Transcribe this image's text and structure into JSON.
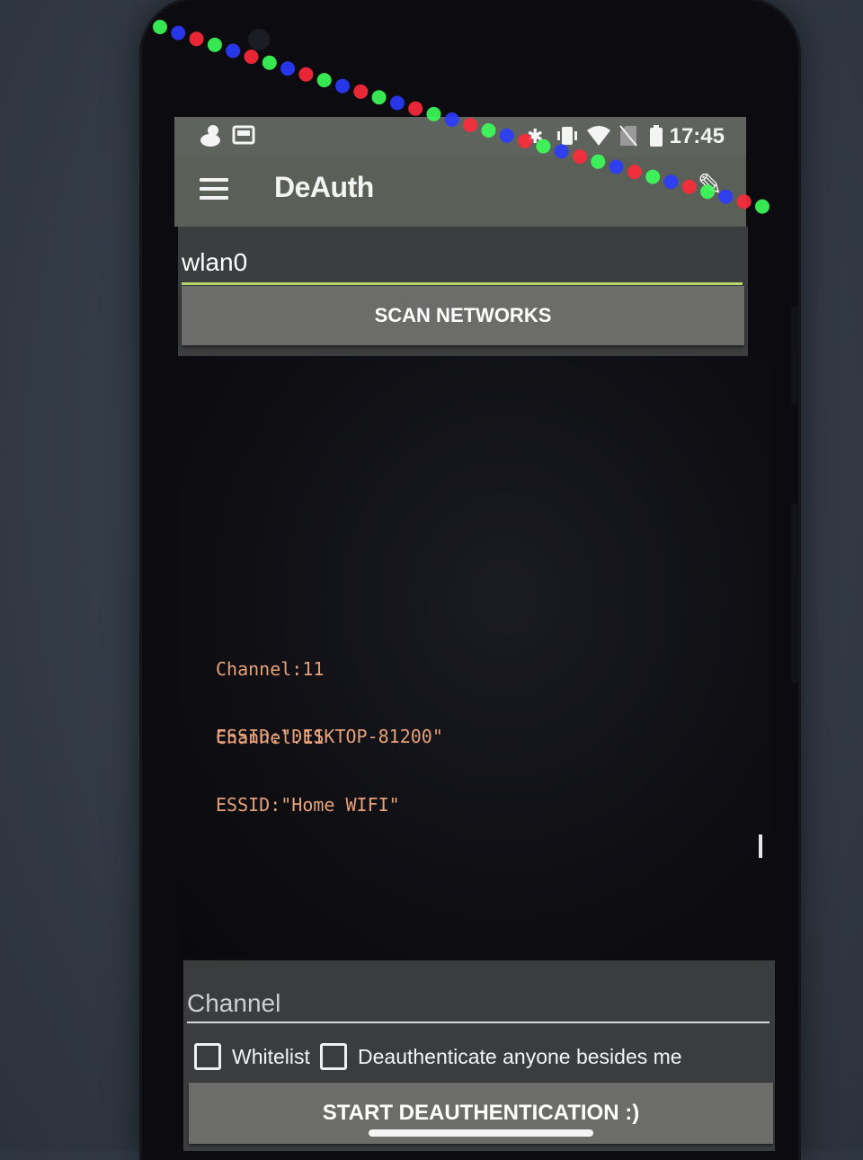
{
  "status_bar": {
    "time": "17:45",
    "left_icons": [
      "duck-icon",
      "cast-icon"
    ],
    "right_icons": [
      "bluetooth-icon",
      "vibrate-icon",
      "wifi-icon",
      "no-sim-icon",
      "battery-icon"
    ]
  },
  "app_bar": {
    "title": "DeAuth",
    "menu_icon": "hamburger-menu-icon",
    "action_icon": "edit-pencil-icon"
  },
  "interface_input": {
    "value": "wlan0"
  },
  "scan_button": {
    "label": "SCAN NETWORKS"
  },
  "networks": [
    {
      "channel": "Channel:11",
      "essid": "ESSID:\"DESKTOP-81200\""
    },
    {
      "channel": "Channel:11",
      "essid": "ESSID:\"Home WIFI\""
    }
  ],
  "channel_input": {
    "placeholder": "Channel",
    "value": ""
  },
  "whitelist_checkbox": {
    "label": "Whitelist",
    "checked": false
  },
  "deauth_others_checkbox": {
    "label": "Deauthenticate anyone besides me",
    "checked": false
  },
  "start_button": {
    "label": "START DEAUTHENTICATION :)"
  },
  "colors": {
    "input_underline_accent": "#b7d66a",
    "output_text": "#e7a178",
    "button_bg": "#6c6d6b"
  }
}
